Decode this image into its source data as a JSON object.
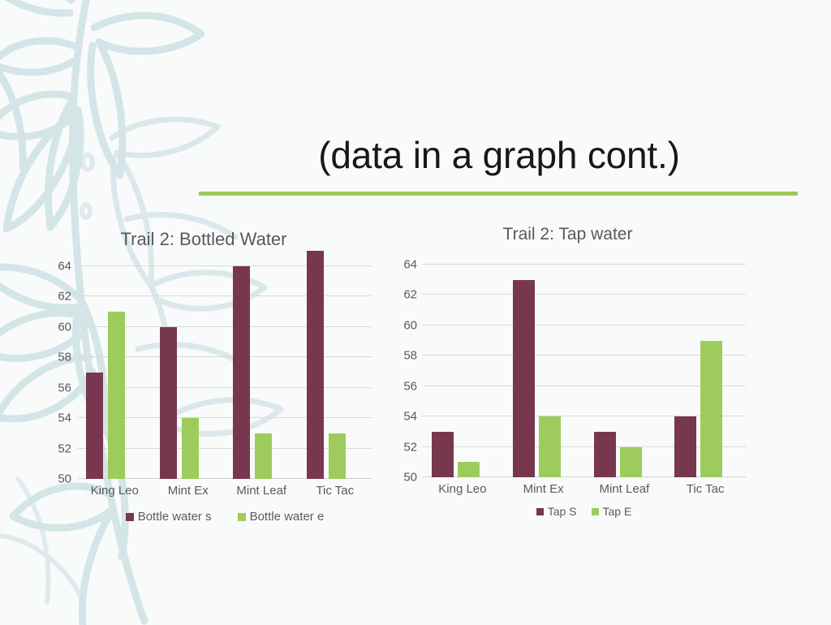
{
  "slide": {
    "title": "(data in a graph cont.)",
    "accent_color": "#9cc85a",
    "background_color": "#f9fbfa",
    "watermark": "floral-leaf-watermark"
  },
  "palette": {
    "series_s": "#76374f",
    "series_e": "#9dcc5d",
    "axis_text": "#595959",
    "gridline": "#d9d9d9"
  },
  "chart_data": [
    {
      "type": "bar",
      "id": "bottled-water",
      "title": "Trail 2: Bottled Water",
      "xlabel": "",
      "ylabel": "",
      "ylim": [
        50,
        64
      ],
      "yticks": [
        50,
        52,
        54,
        56,
        58,
        60,
        62,
        64
      ],
      "ytick_labels": [
        "50",
        "52",
        "54",
        "56",
        "58",
        "60",
        "62",
        "64"
      ],
      "grid": true,
      "legend_position": "bottom",
      "categories": [
        "King Leo",
        "Mint Ex",
        "Mint Leaf",
        "Tic Tac"
      ],
      "series": [
        {
          "name": "Bottle water s",
          "color": "#76374f",
          "values": [
            57,
            60,
            64,
            65
          ]
        },
        {
          "name": "Bottle water e",
          "color": "#9dcc5d",
          "values": [
            61,
            54,
            53,
            53
          ]
        }
      ]
    },
    {
      "type": "bar",
      "id": "tap-water",
      "title": "Trail 2: Tap water",
      "xlabel": "",
      "ylabel": "",
      "ylim": [
        50,
        64
      ],
      "yticks": [
        50,
        52,
        54,
        56,
        58,
        60,
        62,
        64
      ],
      "ytick_labels": [
        "50",
        "52",
        "54",
        "56",
        "58",
        "60",
        "62",
        "64"
      ],
      "grid": true,
      "legend_position": "bottom",
      "categories": [
        "King Leo",
        "Mint Ex",
        "Mint Leaf",
        "Tic Tac"
      ],
      "series": [
        {
          "name": "Tap S",
          "color": "#76374f",
          "values": [
            53,
            63,
            53,
            54
          ]
        },
        {
          "name": "Tap E",
          "color": "#9dcc5d",
          "values": [
            51,
            54,
            52,
            59
          ]
        }
      ]
    }
  ]
}
